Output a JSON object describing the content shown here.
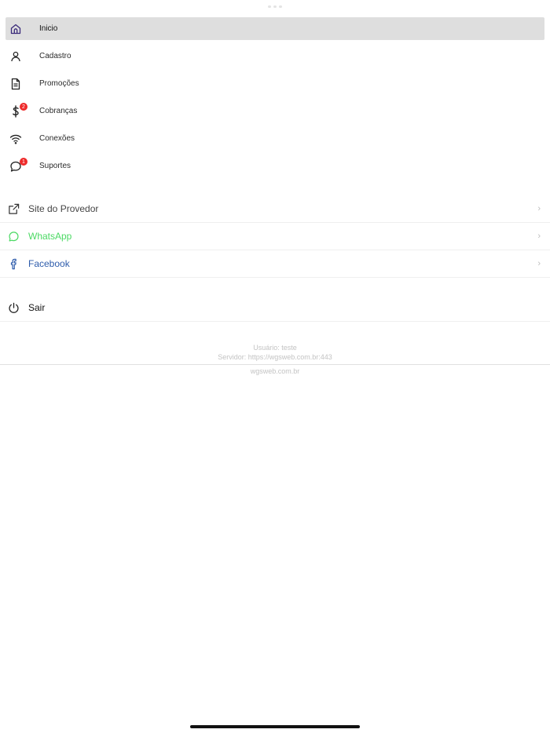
{
  "colors": {
    "active_bg": "#dedede",
    "badge": "#ee2a2a",
    "whatsapp": "#4cd964",
    "facebook": "#2e5cab",
    "muted": "#c3c3c3",
    "home_icon": "#3a2a7a"
  },
  "menu": {
    "items": [
      {
        "label": "Inicio",
        "icon": "home-icon",
        "active": true
      },
      {
        "label": "Cadastro",
        "icon": "user-icon"
      },
      {
        "label": "Promoções",
        "icon": "document-icon"
      },
      {
        "label": "Cobranças",
        "icon": "dollar-icon",
        "badge": "2"
      },
      {
        "label": "Conexões",
        "icon": "wifi-icon"
      },
      {
        "label": "Suportes",
        "icon": "chat-bubble-icon",
        "badge": "1"
      }
    ]
  },
  "links": {
    "items": [
      {
        "label": "Site do Provedor",
        "icon": "external-link-icon"
      },
      {
        "label": "WhatsApp",
        "icon": "whatsapp-icon"
      },
      {
        "label": "Facebook",
        "icon": "facebook-icon"
      }
    ],
    "chevron": "›"
  },
  "logout": {
    "label": "Sair",
    "icon": "power-icon"
  },
  "footer": {
    "user": "Usuário: teste",
    "server": "Servidor: https://wgsweb.com.br:443",
    "domain": "wgsweb.com.br"
  }
}
